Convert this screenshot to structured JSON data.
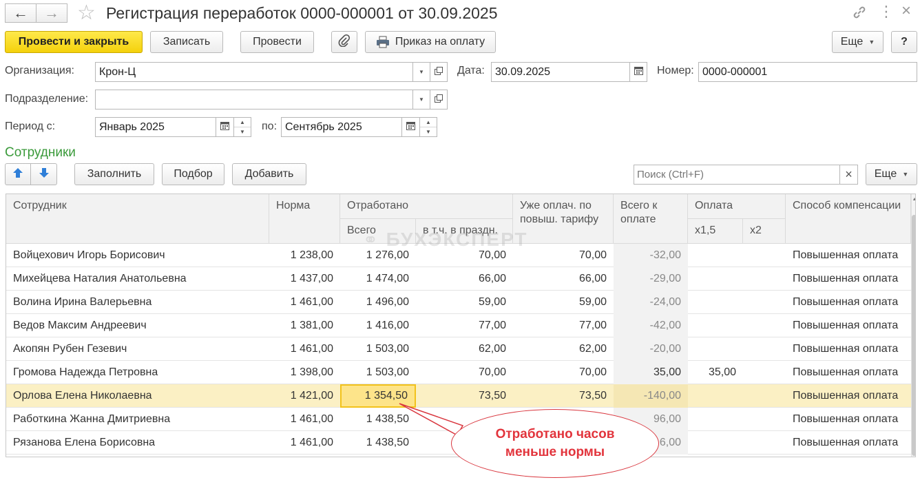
{
  "title": "Регистрация переработок 0000-000001 от 30.09.2025",
  "toolbar": {
    "post_close": "Провести и закрыть",
    "save": "Записать",
    "post": "Провести",
    "print_order": "Приказ на оплату",
    "more": "Еще",
    "help": "?"
  },
  "form": {
    "org_label": "Организация:",
    "org_value": "Крон-Ц",
    "date_label": "Дата:",
    "date_value": "30.09.2025",
    "number_label": "Номер:",
    "number_value": "0000-000001",
    "dept_label": "Подразделение:",
    "dept_value": "",
    "period_label": "Период с:",
    "period_from": "Январь 2025",
    "period_to_label": "по:",
    "period_to": "Сентябрь 2025"
  },
  "employees": {
    "section_title": "Сотрудники",
    "fill": "Заполнить",
    "pick": "Подбор",
    "add": "Добавить",
    "search_placeholder": "Поиск (Ctrl+F)",
    "more": "Еще",
    "watermark": "БУХЭКСПЕРТ",
    "columns": {
      "employee": "Сотрудник",
      "norm": "Норма",
      "worked": "Отработано",
      "worked_total": "Всего",
      "worked_holiday": "в т.ч. в праздн.",
      "already_paid": "Уже оплач. по повыш. тарифу",
      "total_pay": "Всего к оплате",
      "payment": "Оплата",
      "x15": "x1,5",
      "x2": "x2",
      "method": "Способ компенсации"
    },
    "rows": [
      {
        "name": "Войцехович Игорь Борисович",
        "norm": "1 238,00",
        "total": "1 276,00",
        "holiday": "70,00",
        "paid": "70,00",
        "to_pay": "-32,00",
        "x15": "",
        "x2": "",
        "method": "Повышенная оплата"
      },
      {
        "name": "Михейцева Наталия Анатольевна",
        "norm": "1 437,00",
        "total": "1 474,00",
        "holiday": "66,00",
        "paid": "66,00",
        "to_pay": "-29,00",
        "x15": "",
        "x2": "",
        "method": "Повышенная оплата"
      },
      {
        "name": "Волина Ирина Валерьевна",
        "norm": "1 461,00",
        "total": "1 496,00",
        "holiday": "59,00",
        "paid": "59,00",
        "to_pay": "-24,00",
        "x15": "",
        "x2": "",
        "method": "Повышенная оплата"
      },
      {
        "name": "Ведов Максим Андреевич",
        "norm": "1 381,00",
        "total": "1 416,00",
        "holiday": "77,00",
        "paid": "77,00",
        "to_pay": "-42,00",
        "x15": "",
        "x2": "",
        "method": "Повышенная оплата"
      },
      {
        "name": "Акопян Рубен Гезевич",
        "norm": "1 461,00",
        "total": "1 503,00",
        "holiday": "62,00",
        "paid": "62,00",
        "to_pay": "-20,00",
        "x15": "",
        "x2": "",
        "method": "Повышенная оплата"
      },
      {
        "name": "Громова Надежда Петровна",
        "norm": "1 398,00",
        "total": "1 503,00",
        "holiday": "70,00",
        "paid": "70,00",
        "to_pay": "35,00",
        "x15": "35,00",
        "x2": "",
        "method": "Повышенная оплата"
      },
      {
        "name": "Орлова Елена Николаевна",
        "norm": "1 421,00",
        "total": "1 354,50",
        "holiday": "73,50",
        "paid": "73,50",
        "to_pay": "-140,00",
        "x15": "",
        "x2": "",
        "method": "Повышенная оплата"
      },
      {
        "name": "Работкина Жанна Дмитриевна",
        "norm": "1 461,00",
        "total": "1 438,50",
        "holiday": "",
        "paid": "",
        "to_pay": "96,00",
        "x15": "",
        "x2": "",
        "method": "Повышенная оплата"
      },
      {
        "name": "Рязанова Елена Борисовна",
        "norm": "1 461,00",
        "total": "1 438,50",
        "holiday": "",
        "paid": "",
        "to_pay": "6,00",
        "x15": "",
        "x2": "",
        "method": "Повышенная оплата"
      }
    ]
  },
  "callout": {
    "line1": "Отработано часов",
    "line2": "меньше нормы"
  }
}
